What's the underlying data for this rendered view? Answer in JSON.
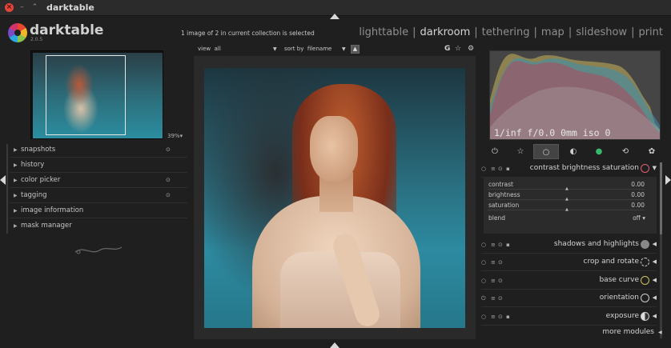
{
  "window": {
    "title": "darktable",
    "close_icon": "×",
    "min_icon": "–",
    "max_icon": "⌃"
  },
  "header": {
    "app_name": "darktable",
    "version": "2.0.5",
    "collection_info": "1 image of 2 in current collection is selected",
    "views": [
      "lighttable",
      "darkroom",
      "tethering",
      "map",
      "slideshow",
      "print"
    ],
    "separator": "|",
    "active_view": "darkroom"
  },
  "navigation": {
    "zoom": "39%"
  },
  "left_modules": [
    {
      "label": "snapshots",
      "has_gear": true
    },
    {
      "label": "history",
      "has_gear": false
    },
    {
      "label": "color picker",
      "has_gear": true
    },
    {
      "label": "tagging",
      "has_gear": true
    },
    {
      "label": "image information",
      "has_gear": false
    },
    {
      "label": "mask manager",
      "has_gear": false
    }
  ],
  "toolbar": {
    "view_label": "view",
    "view_value": "all",
    "sort_label": "sort by",
    "sort_value": "filename",
    "sort_dir": "▲",
    "grouping": "G",
    "star": "☆",
    "gear": "⚙"
  },
  "histogram": {
    "info": "1/inf f/0.0 0mm iso 0"
  },
  "module_group_icons": [
    "power-icon",
    "star-icon",
    "circle-icon",
    "tone-icon",
    "color-icon",
    "correct-icon",
    "effect-icon"
  ],
  "expanded_module": {
    "name": "contrast brightness saturation",
    "sliders": [
      {
        "label": "contrast",
        "value": "0.00"
      },
      {
        "label": "brightness",
        "value": "0.00"
      },
      {
        "label": "saturation",
        "value": "0.00"
      }
    ],
    "blend_label": "blend",
    "blend_value": "off"
  },
  "modules": [
    {
      "name": "shadows and highlights"
    },
    {
      "name": "crop and rotate"
    },
    {
      "name": "base curve"
    },
    {
      "name": "orientation"
    },
    {
      "name": "exposure"
    }
  ],
  "more_modules": "more modules",
  "colors": {
    "accent_close": "#e2463a",
    "bg": "#1f1f1f",
    "panel": "#2b2b2b"
  }
}
